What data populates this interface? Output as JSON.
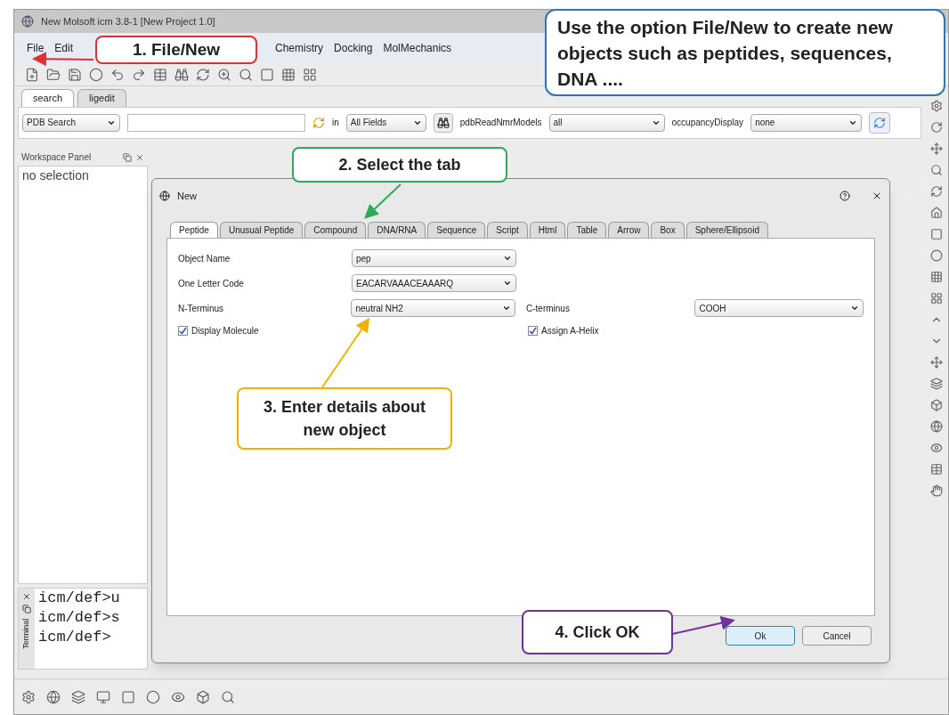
{
  "window": {
    "title": "New Molsoft icm 3.8-1 [New Project 1.0]"
  },
  "menu": [
    {
      "label": "File"
    },
    {
      "label": "Edit"
    },
    {
      "label": "Chemistry"
    },
    {
      "label": "Docking"
    },
    {
      "label": "MolMechanics"
    }
  ],
  "panel_tabs": [
    {
      "label": "search",
      "selected": true
    },
    {
      "label": "ligedit",
      "selected": false
    }
  ],
  "search_bar": {
    "source": "PDB Search",
    "in_label": "in",
    "field": "All Fields",
    "nmr_label": "pdbReadNmrModels",
    "nmr_value": "all",
    "occupancy_label": "occupancyDisplay",
    "occupancy_value": "none"
  },
  "workspace_panel": {
    "title": "Workspace Panel",
    "items": [
      "no selection"
    ]
  },
  "terminal": {
    "title": "Terminal",
    "lines": [
      "icm/def>u",
      "icm/def>s",
      "icm/def>"
    ]
  },
  "dialog": {
    "title": "New",
    "tabs": [
      {
        "label": "Peptide",
        "selected": true
      },
      {
        "label": "Unusual Peptide",
        "selected": false
      },
      {
        "label": "Compound",
        "selected": false
      },
      {
        "label": "DNA/RNA",
        "selected": false
      },
      {
        "label": "Sequence",
        "selected": false
      },
      {
        "label": "Script",
        "selected": false
      },
      {
        "label": "Html",
        "selected": false
      },
      {
        "label": "Table",
        "selected": false
      },
      {
        "label": "Arrow",
        "selected": false
      },
      {
        "label": "Box",
        "selected": false
      },
      {
        "label": "Sphere/Ellipsoid",
        "selected": false
      }
    ],
    "fields": [
      {
        "label": "Object Name",
        "value": "pep"
      },
      {
        "label": "One Letter Code",
        "value": "EACARVAAACEAAARQ"
      },
      {
        "label": "N-Terminus",
        "value": "neutral NH2",
        "extra_label": "C-terminus",
        "extra_value": "COOH"
      }
    ],
    "checkboxes": [
      {
        "label": "Display Molecule",
        "checked": true
      },
      {
        "label": "Assign A-Helix",
        "checked": true
      }
    ],
    "buttons": [
      {
        "label": "Ok",
        "default": true
      },
      {
        "label": "Cancel",
        "default": false
      }
    ]
  },
  "callouts": [
    {
      "text": "1. File/New",
      "color": "#e03030"
    },
    {
      "text": "Use the option File/New to create new objects such as peptides, sequences, DNA ....",
      "color": "#2e75b6"
    },
    {
      "text": "2. Select the tab",
      "color": "#2eaa5a"
    },
    {
      "text": "3. Enter details about new object",
      "color": "#f0b400"
    },
    {
      "text": "4. Click OK",
      "color": "#7030a0"
    }
  ]
}
